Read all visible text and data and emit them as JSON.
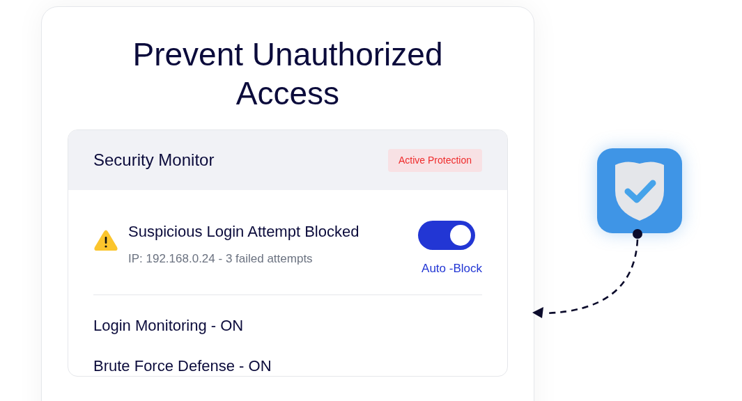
{
  "card": {
    "title": "Prevent Unauthorized Access"
  },
  "monitor": {
    "title": "Security Monitor",
    "badge": "Active Protection",
    "alert": {
      "title": "Suspicious Login Attempt Blocked",
      "detail": "IP: 192.168.0.24 - 3 failed attempts",
      "toggle": {
        "on": true,
        "label": "Auto -Block"
      }
    },
    "statuses": [
      {
        "text": "Login Monitoring - ON"
      },
      {
        "text": "Brute Force Defense - ON"
      }
    ]
  }
}
